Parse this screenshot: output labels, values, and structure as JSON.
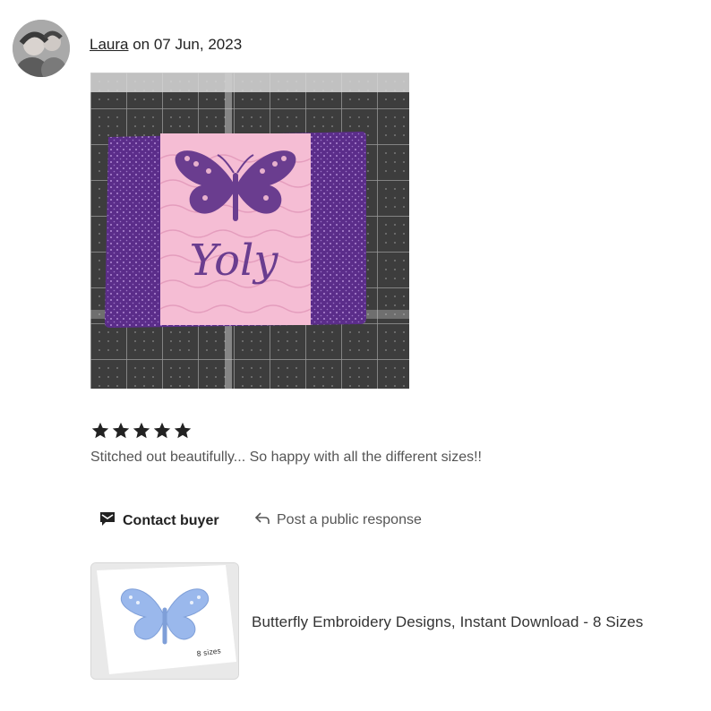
{
  "review": {
    "author": "Laura",
    "date_prefix": " on ",
    "date": "07 Jun, 2023",
    "photo_embroidery_text": "Yoly",
    "rating": 5,
    "text": "Stitched out beautifully... So happy with all the different sizes!!"
  },
  "actions": {
    "contact_label": "Contact buyer",
    "respond_label": "Post a public response"
  },
  "product": {
    "title": "Butterfly Embroidery Designs, Instant Download - 8 Sizes",
    "thumb_badge": "8 sizes"
  },
  "colors": {
    "fabric_purple": "#5b2d8a",
    "fabric_pink": "#f4b9d0",
    "thread_purple": "#6a3d8f",
    "butterfly_blue": "#9ab8ec"
  }
}
